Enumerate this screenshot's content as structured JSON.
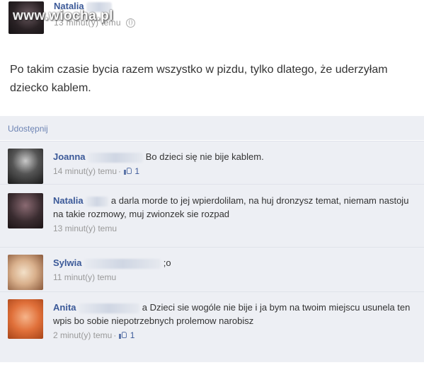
{
  "watermark": "www.wiocha.pl",
  "post": {
    "author_name": "Natalia",
    "timestamp": "13 minut(y) temu",
    "text": "Po takim czasie bycia razem wszystko w pizdu, tylko dlatego, że uderzyłam dziecko kablem."
  },
  "share_label": "Udostępnij",
  "comments": [
    {
      "author": "Joanna",
      "text": "Bo dzieci się nie bije kablem.",
      "timestamp": "14 minut(y) temu",
      "likes": "1"
    },
    {
      "author": "Natalia",
      "text": "a darla morde to jej wpierdolilam, na huj dronzysz temat, niemam nastoju na takie rozmowy, muj zwionzek sie rozpad",
      "timestamp": "13 minut(y) temu",
      "likes": ""
    },
    {
      "author": "Sylwia",
      "text": ";o",
      "timestamp": "11 minut(y) temu",
      "likes": ""
    },
    {
      "author": "Anita",
      "text": "a Dzieci sie wogóle nie bije i ja bym na twoim miejscu usunela ten wpis bo sobie niepotrzebnych prolemow narobisz",
      "timestamp": "2 minut(y) temu",
      "likes": "1"
    }
  ],
  "colors": {
    "name_blue": "#3b5998",
    "comment_bg": "#edeff4",
    "meta_gray": "#999999"
  }
}
